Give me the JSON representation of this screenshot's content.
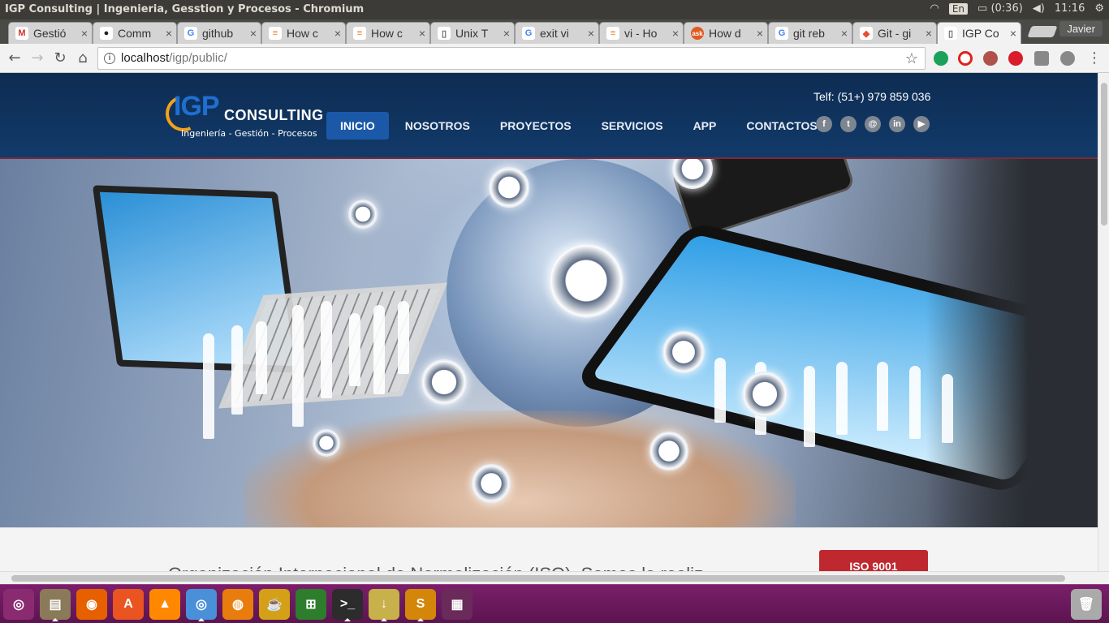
{
  "window": {
    "title": "IGP Consulting | Ingenieria, Gesstion y Procesos - Chromium"
  },
  "system": {
    "language": "En",
    "battery": "(0:36)",
    "clock": "11:16",
    "user": "Javier"
  },
  "tabs": [
    {
      "label": "Gestió",
      "icon": "gmail-icon",
      "active": false
    },
    {
      "label": "Comm",
      "icon": "github-icon",
      "active": false
    },
    {
      "label": "github",
      "icon": "google-icon",
      "active": false
    },
    {
      "label": "How c",
      "icon": "stackoverflow-icon",
      "active": false
    },
    {
      "label": "How c",
      "icon": "stackoverflow-icon",
      "active": false
    },
    {
      "label": "Unix T",
      "icon": "page-icon",
      "active": false
    },
    {
      "label": "exit vi",
      "icon": "google-icon",
      "active": false
    },
    {
      "label": "vi - Ho",
      "icon": "stackoverflow-icon",
      "active": false
    },
    {
      "label": "How d",
      "icon": "askubuntu-icon",
      "active": false
    },
    {
      "label": "git reb",
      "icon": "google-icon",
      "active": false
    },
    {
      "label": "Git - gi",
      "icon": "git-icon",
      "active": false
    },
    {
      "label": "IGP Co",
      "icon": "page-icon",
      "active": true
    }
  ],
  "address_bar": {
    "host": "localhost",
    "path": "/igp/public/"
  },
  "site": {
    "logo": {
      "mark": "IGP",
      "name": "CONSULTING",
      "tagline": "Ingeniería - Gestión - Procesos"
    },
    "nav": [
      "INICIO",
      "NOSOTROS",
      "PROYECTOS",
      "SERVICIOS",
      "APP",
      "CONTACTOS"
    ],
    "phone": "Telf: (51+) 979 859 036",
    "social": [
      {
        "name": "facebook-icon",
        "glyph": "f"
      },
      {
        "name": "twitter-icon",
        "glyph": "t"
      },
      {
        "name": "email-icon",
        "glyph": "@"
      },
      {
        "name": "linkedin-icon",
        "glyph": "in"
      },
      {
        "name": "youtube-icon",
        "glyph": "▶"
      }
    ],
    "slider": {
      "arrows": {
        "prev": "‹",
        "next": "›"
      },
      "thumbnails": 5,
      "active_index": 2
    },
    "intro_text": "Organización Internacional de Normalización (ISO). Somos la realiz",
    "iso_button": "ISO 9001"
  },
  "colors": {
    "header_bg": "#0d2c52",
    "nav_active": "#1b59a8",
    "iso_red": "#c0282f",
    "launcher": "#6b1a5e"
  },
  "launcher": [
    "ubuntu-logo-icon",
    "files-icon",
    "firefox-icon",
    "software-center-icon",
    "vlc-icon",
    "chromium-icon",
    "blender-icon",
    "tea-icon",
    "windows-vm-icon",
    "terminal-icon",
    "downloads-icon",
    "sublime-text-icon",
    "workspaces-icon",
    "trash-icon"
  ]
}
